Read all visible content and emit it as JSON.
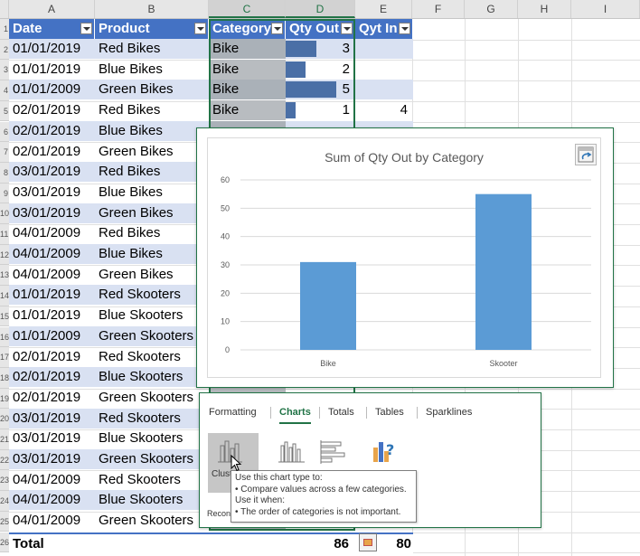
{
  "columns": [
    "A",
    "B",
    "C",
    "D",
    "E",
    "F",
    "G",
    "H",
    "I"
  ],
  "row_numbers": [
    "1",
    "2",
    "3",
    "4",
    "5",
    "6",
    "7",
    "8",
    "9",
    "10",
    "11",
    "12",
    "13",
    "14",
    "15",
    "16",
    "17",
    "18",
    "19",
    "20",
    "21",
    "22",
    "23",
    "24",
    "25",
    "26"
  ],
  "table": {
    "headers": [
      "Date",
      "Product",
      "Category",
      "Qty Out",
      "Qyt In"
    ],
    "rows": [
      {
        "date": "01/01/2019",
        "product": "Red Bikes",
        "category": "Bike",
        "qty_out": "3",
        "qty_in": ""
      },
      {
        "date": "01/01/2019",
        "product": "Blue Bikes",
        "category": "Bike",
        "qty_out": "2",
        "qty_in": ""
      },
      {
        "date": "01/01/2009",
        "product": "Green Bikes",
        "category": "Bike",
        "qty_out": "5",
        "qty_in": ""
      },
      {
        "date": "02/01/2019",
        "product": "Red Bikes",
        "category": "Bike",
        "qty_out": "1",
        "qty_in": "4"
      },
      {
        "date": "02/01/2019",
        "product": "Blue Bikes",
        "category": "",
        "qty_out": "",
        "qty_in": ""
      },
      {
        "date": "02/01/2019",
        "product": "Green Bikes",
        "category": "",
        "qty_out": "",
        "qty_in": ""
      },
      {
        "date": "03/01/2019",
        "product": "Red Bikes",
        "category": "",
        "qty_out": "",
        "qty_in": ""
      },
      {
        "date": "03/01/2019",
        "product": "Blue Bikes",
        "category": "",
        "qty_out": "",
        "qty_in": ""
      },
      {
        "date": "03/01/2019",
        "product": "Green Bikes",
        "category": "",
        "qty_out": "",
        "qty_in": ""
      },
      {
        "date": "04/01/2009",
        "product": "Red Bikes",
        "category": "",
        "qty_out": "",
        "qty_in": ""
      },
      {
        "date": "04/01/2009",
        "product": "Blue Bikes",
        "category": "",
        "qty_out": "",
        "qty_in": ""
      },
      {
        "date": "04/01/2009",
        "product": "Green Bikes",
        "category": "",
        "qty_out": "",
        "qty_in": ""
      },
      {
        "date": "01/01/2019",
        "product": "Red Skooters",
        "category": "",
        "qty_out": "",
        "qty_in": ""
      },
      {
        "date": "01/01/2019",
        "product": "Blue Skooters",
        "category": "",
        "qty_out": "",
        "qty_in": ""
      },
      {
        "date": "01/01/2009",
        "product": "Green Skooters",
        "category": "",
        "qty_out": "",
        "qty_in": ""
      },
      {
        "date": "02/01/2019",
        "product": "Red Skooters",
        "category": "",
        "qty_out": "",
        "qty_in": ""
      },
      {
        "date": "02/01/2019",
        "product": "Blue Skooters",
        "category": "",
        "qty_out": "",
        "qty_in": ""
      },
      {
        "date": "02/01/2019",
        "product": "Green Skooters",
        "category": "",
        "qty_out": "",
        "qty_in": ""
      },
      {
        "date": "03/01/2019",
        "product": "Red Skooters",
        "category": "",
        "qty_out": "",
        "qty_in": ""
      },
      {
        "date": "03/01/2019",
        "product": "Blue Skooters",
        "category": "",
        "qty_out": "",
        "qty_in": ""
      },
      {
        "date": "03/01/2019",
        "product": "Green Skooters",
        "category": "",
        "qty_out": "",
        "qty_in": ""
      },
      {
        "date": "04/01/2009",
        "product": "Red Skooters",
        "category": "",
        "qty_out": "",
        "qty_in": ""
      },
      {
        "date": "04/01/2009",
        "product": "Blue Skooters",
        "category": "",
        "qty_out": "",
        "qty_in": ""
      },
      {
        "date": "04/01/2009",
        "product": "Green Skooters",
        "category": "",
        "qty_out": "",
        "qty_in": ""
      }
    ],
    "databar_values": [
      3,
      2,
      5,
      1
    ],
    "databar_max": 5,
    "total": {
      "label": "Total",
      "qty_out": "86",
      "qty_in": "80"
    }
  },
  "colors": {
    "table_header": "#4472c4",
    "band": "#d9e1f2",
    "databar": "#4a6fa6",
    "chart_bar": "#5b9bd5",
    "excel_green": "#217346"
  },
  "chart_data": {
    "type": "bar",
    "title": "Sum of Qty Out by Category",
    "categories": [
      "Bike",
      "Skooter"
    ],
    "values": [
      31,
      55
    ],
    "yticks": [
      "0",
      "10",
      "20",
      "30",
      "40",
      "50",
      "60"
    ],
    "ylim": [
      0,
      60
    ],
    "grid": true,
    "xlabel": "",
    "ylabel": ""
  },
  "quick_analysis": {
    "tabs": [
      "Formatting",
      "Charts",
      "Totals",
      "Tables",
      "Sparklines"
    ],
    "active_tab": "Charts",
    "chart_types": [
      "clustered-bar-icon",
      "clustered-column-icon",
      "stacked-bar-icon",
      "more-charts-icon"
    ],
    "selected_label": "Clust",
    "recommended_label": "Recon"
  },
  "tooltip": {
    "lines": [
      "Use this chart type to:",
      "• Compare values across a few categories.",
      "Use it when:",
      "• The order of categories is not important."
    ]
  },
  "icons": {
    "refresh": "chart-refresh-icon",
    "quick_analysis": "quick-analysis-icon",
    "cursor": "mouse-pointer-icon"
  }
}
